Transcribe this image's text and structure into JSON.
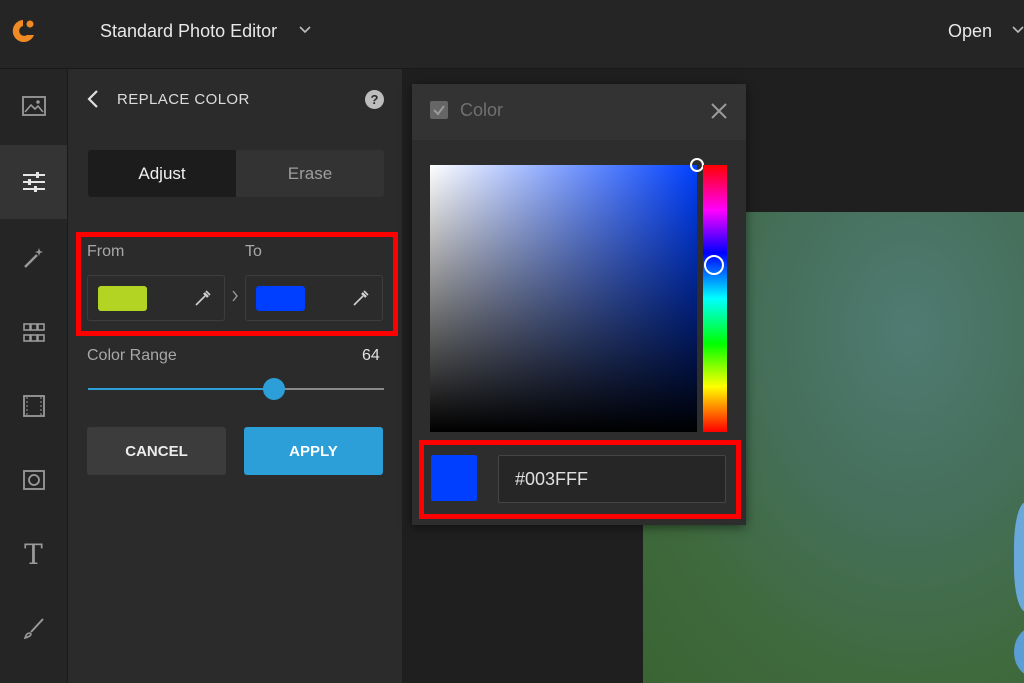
{
  "header": {
    "logo_icon": "app-logo-icon",
    "app_title": "Standard Photo Editor",
    "open_label": "Open"
  },
  "toolbar": {
    "tools": [
      {
        "icon": "image-icon",
        "active": false
      },
      {
        "icon": "sliders-icon",
        "active": true
      },
      {
        "icon": "magic-wand-icon",
        "active": false
      },
      {
        "icon": "grid-icon",
        "active": false
      },
      {
        "icon": "film-frame-icon",
        "active": false
      },
      {
        "icon": "frame-icon",
        "active": false
      },
      {
        "icon": "text-icon",
        "glyph": "T",
        "active": false
      },
      {
        "icon": "brush-icon",
        "active": false
      }
    ]
  },
  "panel": {
    "title": "REPLACE COLOR",
    "help_label": "?",
    "tabs": [
      {
        "label": "Adjust",
        "active": true
      },
      {
        "label": "Erase",
        "active": false
      }
    ],
    "from_label": "From",
    "to_label": "To",
    "from_color": "#b4d423",
    "to_color": "#003fff",
    "range_label": "Color Range",
    "range_value": "64",
    "range_fraction": 0.63,
    "cancel_label": "CANCEL",
    "apply_label": "APPLY",
    "accent_color": "#2c9fd9"
  },
  "color_dialog": {
    "title": "Color",
    "hex_value": "#003FFF",
    "current_color": "#003fff",
    "hue_degrees": 225,
    "saturation": 1.0,
    "brightness": 1.0
  },
  "highlight_color": "#ff0000"
}
